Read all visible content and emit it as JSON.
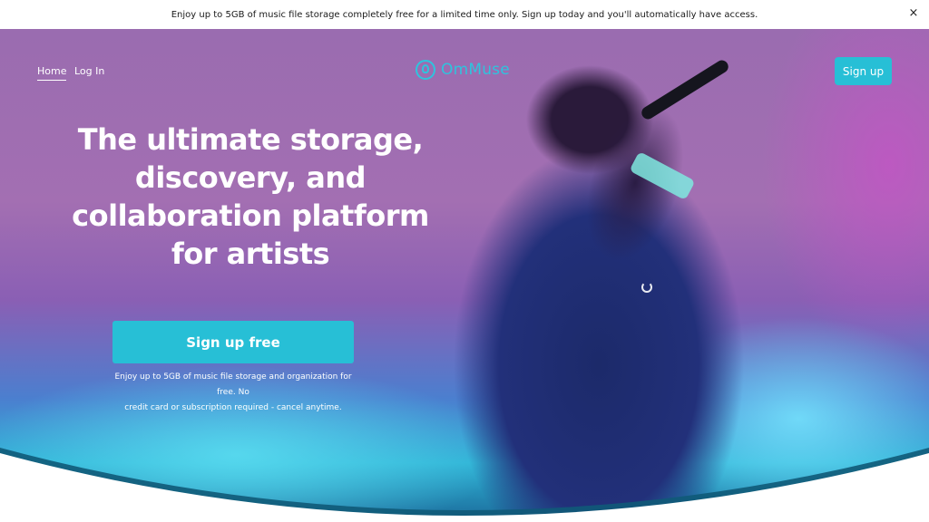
{
  "announcement": {
    "text": "Enjoy up to 5GB of music file storage completely free for a limited time only. Sign up today and you'll automatically have access.",
    "close_symbol": "×"
  },
  "nav": {
    "items": [
      {
        "label": "Home",
        "active": true
      },
      {
        "label": "Log In",
        "active": false
      }
    ]
  },
  "logo": {
    "text": "OmMuse",
    "icon": "ommuse-logo-icon",
    "color": "#2ec4dd"
  },
  "header": {
    "signup_label": "Sign up"
  },
  "hero": {
    "headline_lines": [
      "The ultimate storage,",
      "discovery, and",
      "collaboration platform",
      "for artists"
    ],
    "cta_label": "Sign up free",
    "subtext_lines": [
      "Enjoy up to 5GB of music file storage and organization for free. No",
      "credit card or subscription required - cancel anytime."
    ]
  },
  "colors": {
    "accent": "#27bfd6",
    "text_on_hero": "#ffffff"
  }
}
